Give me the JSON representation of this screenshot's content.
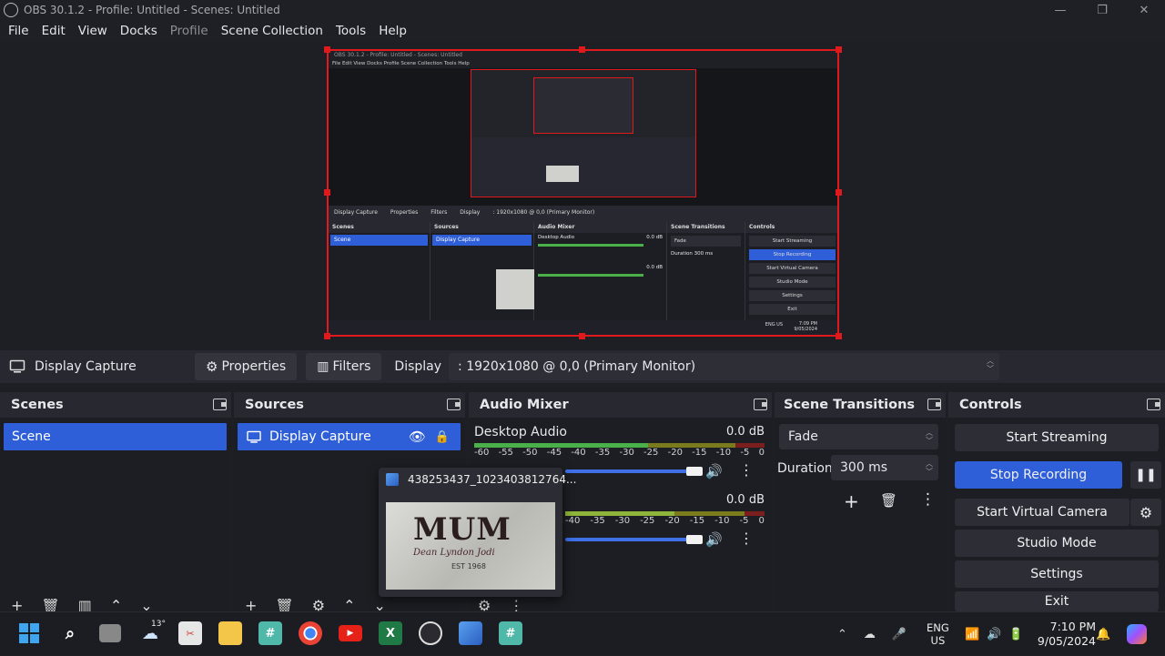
{
  "window": {
    "title": "OBS 30.1.2 - Profile: Untitled - Scenes: Untitled",
    "minimize": "—",
    "maximize": "❐",
    "close": "✕"
  },
  "menu": {
    "items": [
      "File",
      "Edit",
      "View",
      "Docks",
      "Profile",
      "Scene Collection",
      "Tools",
      "Help"
    ]
  },
  "mini": {
    "title": "OBS 30.1.2 - Profile: Untitled - Scenes: Untitled",
    "menu": "File   Edit   View   Docks   Profile   Scene Collection   Tools   Help",
    "source": "Display Capture",
    "properties": "Properties",
    "filters": "Filters",
    "display": "Display",
    "display_value": ": 1920x1080 @ 0,0 (Primary Monitor)",
    "panels": [
      "Scenes",
      "Sources",
      "Audio Mixer",
      "Scene Transitions",
      "Controls"
    ],
    "scene": "Scene",
    "desktop_audio": "Desktop Audio",
    "db1": "0.0 dB",
    "db2": "0.0 dB",
    "fade": "Fade",
    "duration": "Duration",
    "duration_value": "300 ms",
    "controls": [
      "Start Streaming",
      "Stop Recording",
      "Start Virtual Camera",
      "Studio Mode",
      "Settings",
      "Exit"
    ],
    "tray_lang": "ENG US",
    "tray_time": "7:09 PM",
    "tray_date": "9/05/2024",
    "thumb_file": "438253437_1023403812764..."
  },
  "source_toolbar": {
    "current_source": "Display Capture",
    "properties": "Properties",
    "filters": "Filters",
    "display_label": "Display",
    "display_value": ": 1920x1080 @ 0,0 (Primary Monitor)"
  },
  "scenes": {
    "title": "Scenes",
    "items": [
      "Scene"
    ]
  },
  "sources": {
    "title": "Sources",
    "items": [
      "Display Capture"
    ]
  },
  "audio_mixer": {
    "title": "Audio Mixer",
    "channels": [
      {
        "name": "Desktop Audio",
        "db": "0.0 dB"
      },
      {
        "name": "",
        "db": "0.0 dB"
      }
    ],
    "scale": [
      "-60",
      "-55",
      "-50",
      "-45",
      "-40",
      "-35",
      "-30",
      "-25",
      "-20",
      "-15",
      "-10",
      "-5",
      "0"
    ],
    "scale_partial": [
      "-40",
      "-35",
      "-30",
      "-25",
      "-20",
      "-15",
      "-10",
      "-5",
      "0"
    ],
    "fader_level": 1.0
  },
  "transitions": {
    "title": "Scene Transitions",
    "selected": "Fade",
    "duration_label": "Duration",
    "duration_value": "300 ms"
  },
  "controls": {
    "title": "Controls",
    "start_streaming": "Start Streaming",
    "stop_recording": "Stop Recording",
    "start_virtual_camera": "Start Virtual Camera",
    "studio_mode": "Studio Mode",
    "settings": "Settings",
    "exit": "Exit"
  },
  "thumbnail": {
    "filename": "438253437_1023403812764...",
    "image_text": "MUM",
    "image_sub": "Dean  Lyndon  Jodi",
    "image_est": "EST 1968"
  },
  "taskbar": {
    "weather_temp": "13°",
    "lang_line1": "ENG",
    "lang_line2": "US",
    "time": "7:10 PM",
    "date": "9/05/2024"
  },
  "colors": {
    "accent": "#2f5fd8",
    "selection_border": "#e0191c",
    "background": "#1e1f24",
    "dock_header": "#272830"
  }
}
